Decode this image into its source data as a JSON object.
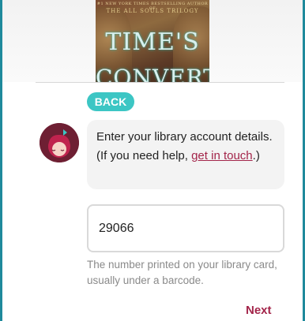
{
  "book": {
    "series_line1": "#1 NEW YORK TIMES BESTSELLING AUTHOR OF",
    "series_line2": "THE ALL SOULS TRILOGY",
    "title_line1": "TIME'S",
    "title_line2": "CONVERT"
  },
  "back_button": {
    "label": "BACK"
  },
  "message": {
    "text_before": "Enter your library account details. (If you need help, ",
    "link_text": "get in touch",
    "text_after": ".)"
  },
  "card_input": {
    "value": "29066"
  },
  "hint": {
    "text": "The number printed on your library card, usually under a barcode."
  },
  "next_button": {
    "label": "Next"
  },
  "colors": {
    "frame": "#1f8a9c",
    "back_button": "#3cc6c4",
    "link": "#a3254a",
    "avatar": "#6e1f33"
  }
}
